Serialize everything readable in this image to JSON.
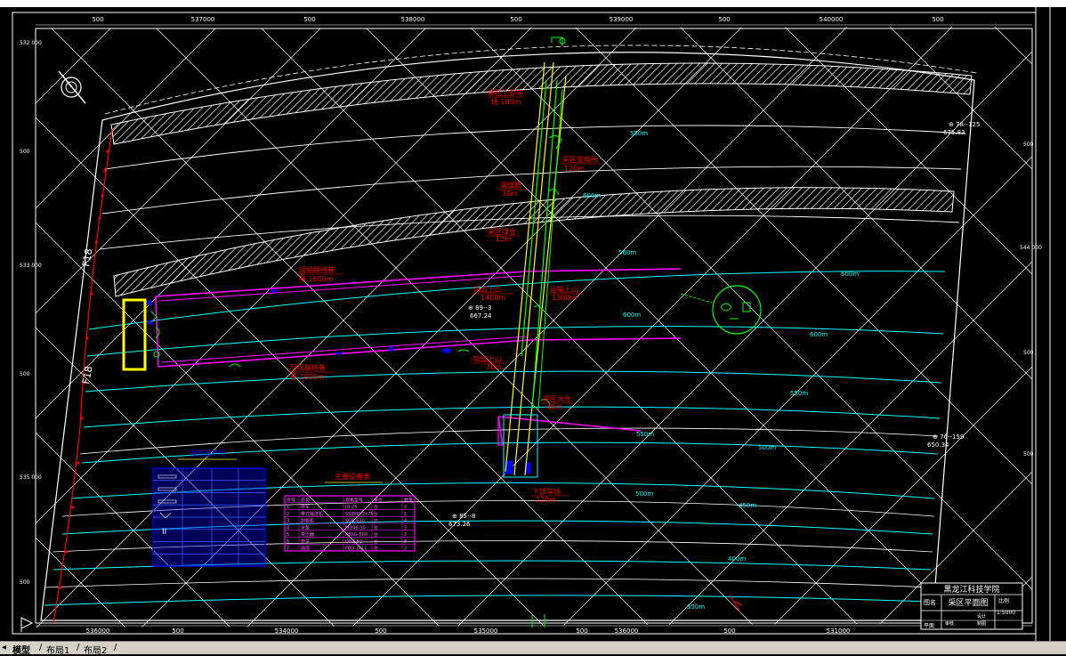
{
  "colors": {
    "background": "#000000",
    "frame": "#ffffff",
    "grid": "#ffffff",
    "contour": "#00ffff",
    "roadway_magenta": "#ff00ff",
    "shaft_yellow": "#ffff00",
    "shaft_green": "#00ff00",
    "label_red": "#ff0000",
    "legend_blue": "#0000ff",
    "table_magenta": "#ff00ff",
    "highlight_yellow": "#ffff00",
    "tab_bar": "#d4d0c8"
  },
  "top_ruler": [
    "500",
    "537000",
    "500",
    "538000",
    "500",
    "539000",
    "500",
    "540000",
    "500"
  ],
  "bottom_ruler": [
    "536000",
    "500",
    "534000",
    "500",
    "535000",
    "500",
    "536000",
    "500",
    "531000"
  ],
  "left_ruler": [
    "532\n000",
    "500",
    "533\n000",
    "500",
    "535\n000",
    "500"
  ],
  "right_ruler": [
    "500",
    "544\n000",
    "500",
    "500"
  ],
  "contours": {
    "c1": "550m",
    "c2": "600m",
    "c3": "560m",
    "c4": "600m",
    "c5": "600m",
    "c6": "600m",
    "c7": "550m",
    "c8": "500m",
    "c9": "550m",
    "c10": "450m",
    "c11": "400m",
    "c12": "350m"
  },
  "fault_label_top": "F18",
  "fault_label_bottom": "F18",
  "labels": {
    "l1_a": "采区上部车",
    "l1_b": "场  100m",
    "l2_a": "采区变电所",
    "l2_b": "120m",
    "l3_a": "溜煤眼",
    "l3_b": "30m",
    "l4_a": "采区煤仓",
    "l4_b": "15m",
    "l5_a": "运输联络巷",
    "l5_b": "巷  1600m",
    "l6_a": "运输上山",
    "l6_b": "1300m",
    "l7_a": "轨道上山",
    "l7_b": "1400m",
    "l8_a": "回风联络巷",
    "l8_b": "巷  1600m",
    "l9_a": "轨道上山",
    "l9_b": "70m",
    "l10_a": "采区水仓",
    "l10_b": "40m",
    "l11_a": "下部车场",
    "l11_b": "120m"
  },
  "points": {
    "p1_name": "⊕ 78--125",
    "p1_val": "675.83",
    "p2_name": "⊕ 89--3",
    "p2_val": "667.24",
    "p3_name": "⊕ 76--159",
    "p3_val": "650.34",
    "p4_name": "⊕ 85--8",
    "p4_val": "673.26"
  },
  "legend_title": "图例及符号",
  "table_title": "主要设备表",
  "table_rows": [
    [
      "序号",
      "名称",
      "规格型号",
      "单位",
      "数量"
    ],
    [
      "1",
      "绞车",
      "JD-25",
      "台",
      "2"
    ],
    [
      "2",
      "带式输送机",
      "SSJ800/2x75",
      "台",
      "1"
    ],
    [
      "3",
      "刮板机",
      "SGB-630",
      "台",
      "4"
    ],
    [
      "4",
      "水泵",
      "MD46-30",
      "台",
      "3"
    ],
    [
      "5",
      "变压器",
      "KBSG-500",
      "台",
      "2"
    ],
    [
      "6",
      "开关",
      "QBZ-80",
      "台",
      "8"
    ],
    [
      "7",
      "局扇",
      "FBD-2x11",
      "台",
      "2"
    ]
  ],
  "title_block": {
    "school": "黑龙江科技学院",
    "drawing": "采区平面图",
    "left_a": "图名",
    "left_b": "平面",
    "right_a": "比例",
    "right_b": "1:5000",
    "r1": "设计",
    "r2": "制图",
    "r3": "审核"
  },
  "tabs": [
    "模型",
    "布局1",
    "布局2"
  ]
}
